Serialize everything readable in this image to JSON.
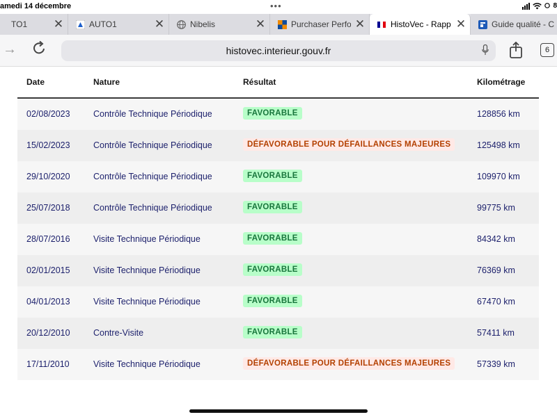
{
  "status": {
    "time": "amedi 14 décembre",
    "dots": "•••",
    "battery": "8"
  },
  "tabs": [
    {
      "label": "TO1",
      "favicon": "none",
      "active": false
    },
    {
      "label": "AUTO1",
      "favicon": "auto1-logo-icon",
      "active": false
    },
    {
      "label": "Nibelis",
      "favicon": "globe-icon",
      "active": false
    },
    {
      "label": "Purchaser Perfo",
      "favicon": "purchaser-logo-icon",
      "active": false
    },
    {
      "label": "HistoVec - Rapp",
      "favicon": "french-flag-icon",
      "active": true
    },
    {
      "label": "Guide qualité - C",
      "favicon": "guide-logo-icon",
      "active": false
    }
  ],
  "address": {
    "url": "histovec.interieur.gouv.fr",
    "tab_count": "6"
  },
  "table": {
    "headers": {
      "date": "Date",
      "nature": "Nature",
      "result": "Résultat",
      "km": "Kilométrage"
    },
    "rows": [
      {
        "date": "02/08/2023",
        "nature": "Contrôle Technique Périodique",
        "result": "FAVORABLE",
        "status": "ok",
        "km": "128856 km"
      },
      {
        "date": "15/02/2023",
        "nature": "Contrôle Technique Périodique",
        "result": "DÉFAVORABLE POUR DÉFAILLANCES MAJEURES",
        "status": "ko",
        "km": "125498 km"
      },
      {
        "date": "29/10/2020",
        "nature": "Contrôle Technique Périodique",
        "result": "FAVORABLE",
        "status": "ok",
        "km": "109970 km"
      },
      {
        "date": "25/07/2018",
        "nature": "Contrôle Technique Périodique",
        "result": "FAVORABLE",
        "status": "ok",
        "km": "99775 km"
      },
      {
        "date": "28/07/2016",
        "nature": "Visite Technique Périodique",
        "result": "FAVORABLE",
        "status": "ok",
        "km": "84342 km"
      },
      {
        "date": "02/01/2015",
        "nature": "Visite Technique Périodique",
        "result": "FAVORABLE",
        "status": "ok",
        "km": "76369 km"
      },
      {
        "date": "04/01/2013",
        "nature": "Visite Technique Périodique",
        "result": "FAVORABLE",
        "status": "ok",
        "km": "67470 km"
      },
      {
        "date": "20/12/2010",
        "nature": "Contre-Visite",
        "result": "FAVORABLE",
        "status": "ok",
        "km": "57411 km"
      },
      {
        "date": "17/11/2010",
        "nature": "Visite Technique Périodique",
        "result": "DÉFAVORABLE POUR DÉFAILLANCES MAJEURES",
        "status": "ko",
        "km": "57339 km"
      }
    ]
  },
  "colors": {
    "accent_text": "#1b1f6b",
    "favorable_bg": "#b8fec9",
    "favorable_text": "#18753c",
    "unfavorable_bg": "#ffe9e6",
    "unfavorable_text": "#b34000"
  }
}
